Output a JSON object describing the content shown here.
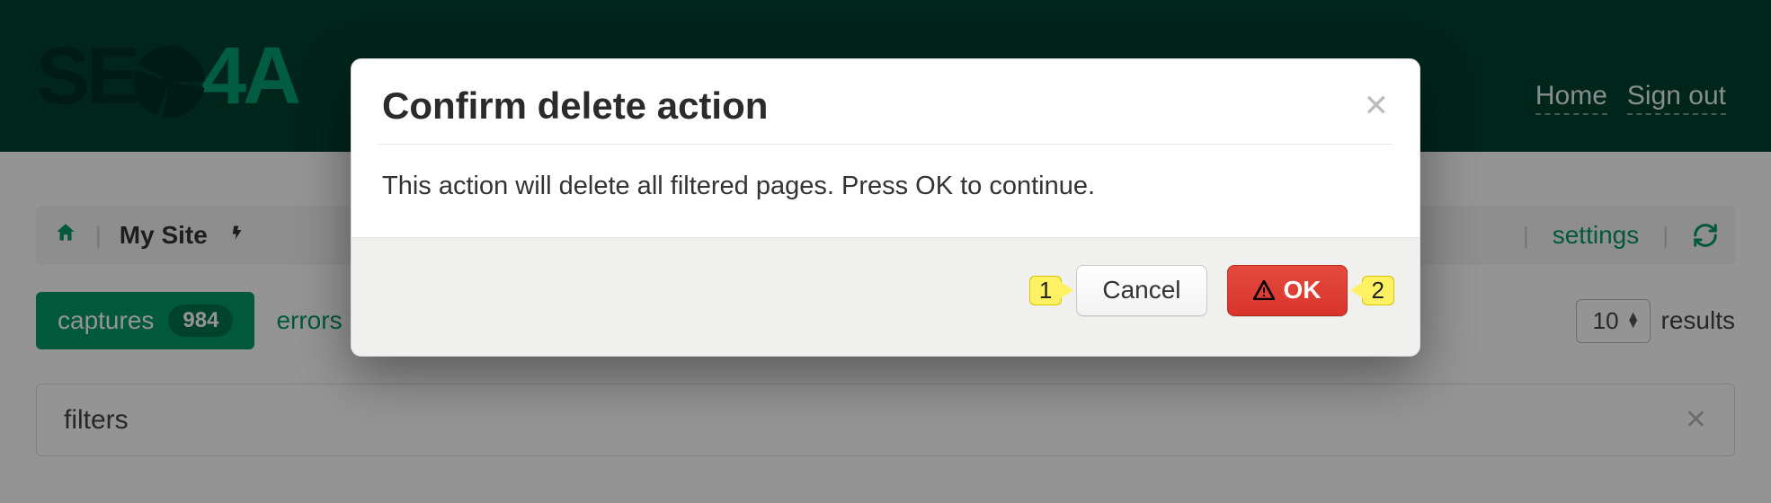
{
  "header": {
    "logo_prefix": "SE",
    "logo_suffix": "4A",
    "nav": {
      "home": "Home",
      "signout": "Sign out"
    }
  },
  "breadcrumb": {
    "site_label": "My Site",
    "settings_label": "settings"
  },
  "tabs": {
    "captures_label": "captures",
    "captures_count": "984",
    "errors_label": "errors"
  },
  "results": {
    "select_value": "10",
    "label": "results"
  },
  "filters": {
    "label": "filters"
  },
  "modal": {
    "title": "Confirm delete action",
    "body": "This action will delete all filtered pages. Press OK to continue.",
    "cancel_label": "Cancel",
    "ok_label": "OK"
  },
  "annotations": {
    "one": "1",
    "two": "2"
  }
}
